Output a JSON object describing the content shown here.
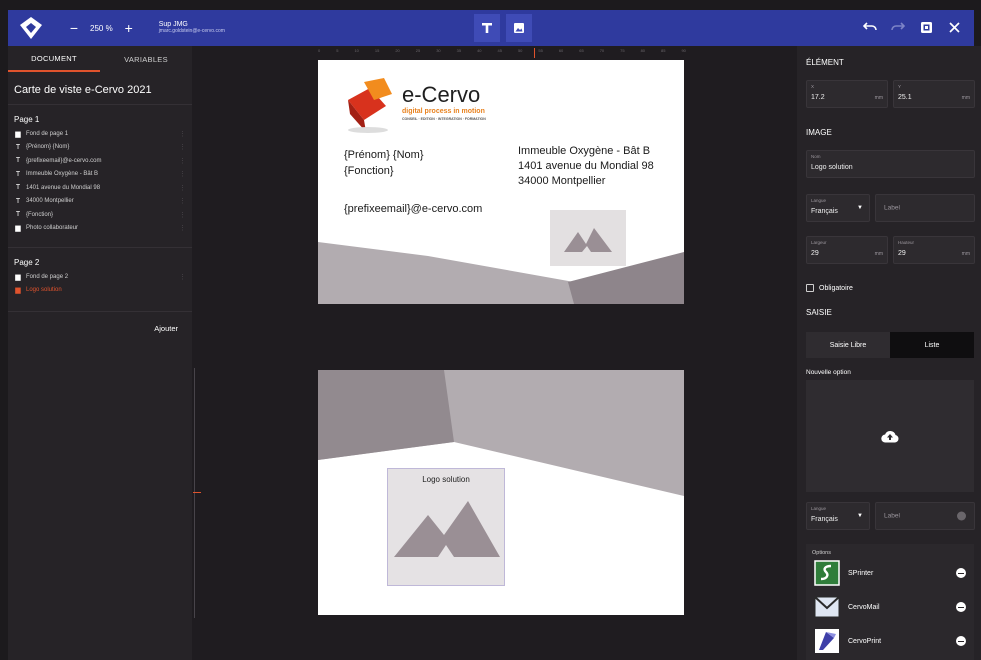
{
  "topbar": {
    "zoom_minus": "−",
    "zoom_value": "250 %",
    "zoom_plus": "+",
    "user_name": "Sup JMG",
    "user_email": "jmarc.goldstein@e-cervo.com"
  },
  "left": {
    "tabs": [
      "DOCUMENT",
      "VARIABLES"
    ],
    "document_title": "Carte de viste e-Cervo 2021",
    "page1_title": "Page 1",
    "page1_items": [
      {
        "label": "Fond de page 1",
        "icon": "image-icon"
      },
      {
        "label": "{Prénom} {Nom}",
        "icon": "text-icon"
      },
      {
        "label": "{prefixeemail}@e-cervo.com",
        "icon": "text-icon"
      },
      {
        "label": "Immeuble Oxygène - Bât B",
        "icon": "text-icon"
      },
      {
        "label": "1401 avenue du Mondial 98",
        "icon": "text-icon"
      },
      {
        "label": "34000 Montpellier",
        "icon": "text-icon"
      },
      {
        "label": "{Fonction}",
        "icon": "text-icon"
      },
      {
        "label": "Photo collaborateur",
        "icon": "image-icon"
      }
    ],
    "page2_title": "Page 2",
    "page2_items": [
      {
        "label": "Fond de page 2",
        "icon": "image-icon"
      },
      {
        "label": "Logo solution",
        "icon": "image-icon"
      }
    ],
    "add_label": "Ajouter"
  },
  "ruler_ticks": [
    "0",
    "5",
    "10",
    "15",
    "20",
    "25",
    "30",
    "35",
    "40",
    "45",
    "50",
    "55",
    "60",
    "65",
    "70",
    "75",
    "80",
    "85",
    "90"
  ],
  "card1": {
    "brand_name": "e-Cervo",
    "brand_tagline": "digital process in motion",
    "brand_sub": "CONSEIL · EDITION · INTEGRATION · FORMATION",
    "name_line": "{Prénom} {Nom}",
    "function_line": "{Fonction}",
    "email_line": "{prefixeemail}@e-cervo.com",
    "address1": "Immeuble Oxygène - Bât B",
    "address2": "1401 avenue du Mondial 98",
    "address3": "34000 Montpellier"
  },
  "card2": {
    "logo_label": "Logo solution"
  },
  "right": {
    "element_title": "ÉLÉMENT",
    "x_label": "X",
    "x_value": "17.2",
    "y_label": "Y",
    "y_value": "25.1",
    "unit": "mm",
    "image_title": "IMAGE",
    "nom_label": "Nom",
    "nom_value": "Logo solution",
    "langue_label": "Langue",
    "langue_value": "Français",
    "label_placeholder": "Label",
    "largeur_label": "Largeur",
    "largeur_value": "29",
    "hauteur_label": "Hauteur",
    "hauteur_value": "29",
    "obligatoire": "Obligatoire",
    "saisie_title": "SAISIE",
    "saisie_libre": "Saisie Libre",
    "liste": "Liste",
    "nouvelle_option": "Nouvelle option",
    "options_label": "Options",
    "options": [
      {
        "name": "SPrinter"
      },
      {
        "name": "CervoMail"
      },
      {
        "name": "CervoPrint"
      }
    ]
  },
  "colors": {
    "topbar": "#2f3a9e",
    "accent": "#e0532d",
    "panel": "#262327",
    "canvas": "#1f1c20"
  }
}
